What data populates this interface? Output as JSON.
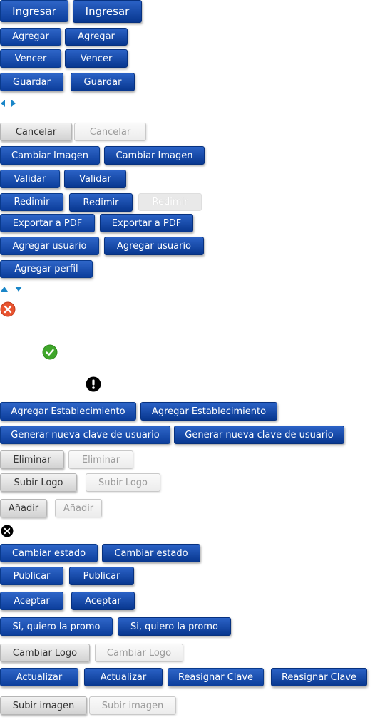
{
  "buttons": {
    "ingresar": "Ingresar",
    "agregar": "Agregar",
    "vencer": "Vencer",
    "guardar": "Guardar",
    "cancelar": "Cancelar",
    "cambiar_imagen": "Cambiar Imagen",
    "validar": "Validar",
    "redimir": "Redimir",
    "exportar_pdf": "Exportar a PDF",
    "agregar_usuario": "Agregar usuario",
    "agregar_perfil": "Agregar perfil",
    "agregar_establecimiento": "Agregar Establecimiento",
    "generar_clave": "Generar nueva clave de usuario",
    "eliminar": "Eliminar",
    "subir_logo": "Subir Logo",
    "anadir": "Añadir",
    "cambiar_estado": "Cambiar estado",
    "publicar": "Publicar",
    "aceptar": "Aceptar",
    "si_promo": "Si, quiero la promo",
    "cambiar_logo": "Cambiar Logo",
    "actualizar": "Actualizar",
    "reasignar_clave": "Reasignar Clave",
    "subir_imagen": "Subir imagen"
  },
  "icons": {
    "arrow_left": "arrow-left-icon",
    "arrow_right": "arrow-right-icon",
    "arrow_up": "arrow-up-icon",
    "arrow_down": "arrow-down-icon",
    "error": "error-circle-icon",
    "success": "check-circle-icon",
    "warning": "exclamation-circle-icon",
    "close": "close-circle-icon"
  },
  "colors": {
    "primary_blue": "#0c3e9c",
    "arrow_blue": "#1a86c8",
    "error_red": "#e8532f",
    "success_green": "#3fa62a",
    "gray_button": "#d2d2d2"
  }
}
